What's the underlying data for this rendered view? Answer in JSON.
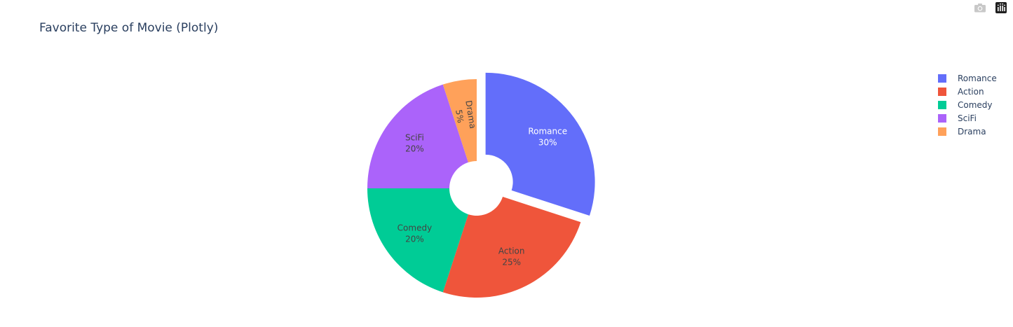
{
  "toolbar": {
    "camera_icon": "camera-icon",
    "plotly_logo_icon": "plotly-logo-icon"
  },
  "chart_data": {
    "type": "pie",
    "title": "Favorite Type of Movie (Plotly)",
    "hole": 0.25,
    "textinfo": "label+percent",
    "legend_placement": "top-right",
    "labels": [
      "Romance",
      "Action",
      "Comedy",
      "SciFi",
      "Drama"
    ],
    "values": [
      30,
      25,
      20,
      20,
      5
    ],
    "pull": [
      0.1,
      0,
      0,
      0,
      0
    ],
    "percents": [
      "30%",
      "25%",
      "20%",
      "20%",
      "5%"
    ],
    "colors": [
      "#636efa",
      "#ef553b",
      "#00cc96",
      "#ab63fa",
      "#ffa15a"
    ],
    "label_colors": [
      "#ffffff",
      "#444444",
      "#444444",
      "#444444",
      "#444444"
    ]
  }
}
